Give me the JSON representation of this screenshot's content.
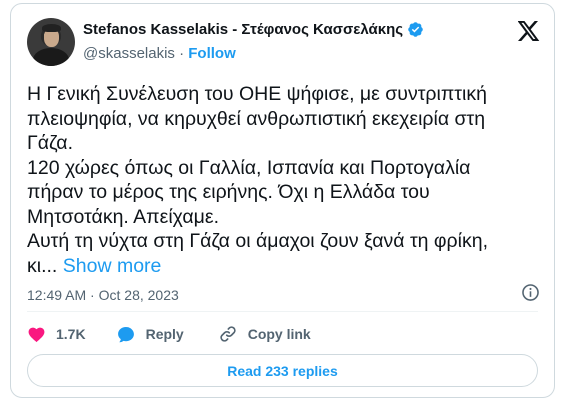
{
  "author": {
    "name": "Stefanos Kasselakis - Στέφανος Κασσελάκης",
    "handle": "@skasselakis",
    "separator": "·",
    "follow_label": "Follow"
  },
  "tweet": {
    "lines": [
      "Η Γενική Συνέλευση του ΟΗΕ ψήφισε, με συντριπτική",
      "πλειοψηφία, να κηρυχθεί ανθρωπιστική εκεχειρία στη",
      "Γάζα.",
      "120 χώρες όπως οι Γαλλία, Ισπανία και Πορτογαλία",
      "πήραν το μέρος της ειρήνης. Όχι η Ελλάδα του",
      "Μητσοτάκη. Απείχαμε.",
      "Αυτή τη νύχτα στη Γάζα οι άμαχοι ζουν ξανά τη φρίκη,"
    ],
    "last_line_prefix": "κι...",
    "show_more_label": "Show more",
    "time": "12:49 AM",
    "date": "Oct 28, 2023",
    "meta_separator": "·"
  },
  "actions": {
    "likes": "1.7K",
    "reply_label": "Reply",
    "copy_link_label": "Copy link"
  },
  "replies_button_label": "Read 233 replies",
  "colors": {
    "accent": "#1d9bf0",
    "like": "#f91880",
    "text": "#0f1419",
    "muted": "#536471",
    "border": "#cfd9de"
  },
  "icons": [
    "verified-badge-icon",
    "x-logo-icon",
    "info-icon",
    "heart-icon",
    "reply-bubble-icon",
    "link-icon"
  ]
}
